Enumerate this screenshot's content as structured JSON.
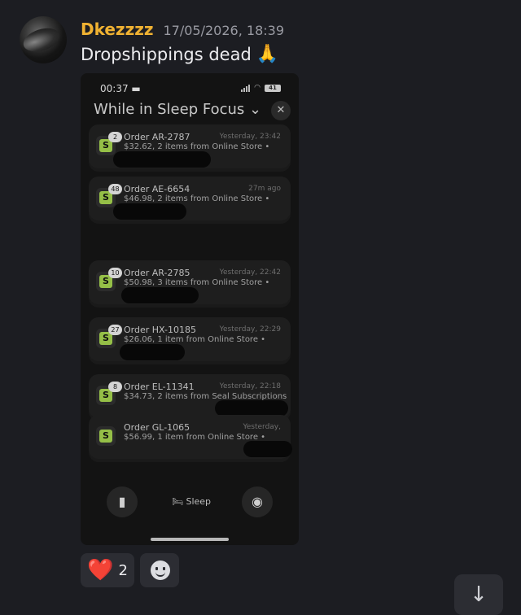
{
  "message": {
    "author": "Dkezzzz",
    "timestamp": "17/05/2026, 18:39",
    "text": "Dropshippings dead",
    "emoji": "🙏"
  },
  "phone": {
    "status_time": "00:37",
    "battery": "41",
    "focus_title": "While in Sleep Focus ⌄",
    "close_glyph": "✕",
    "notifications": [
      {
        "badge": "2",
        "title": "Order AR-2787",
        "time": "Yesterday, 23:42",
        "body": "$32.62, 2 items from Online Store •"
      },
      {
        "badge": "48",
        "title": "Order AE-6654",
        "time": "27m ago",
        "body": "$46.98, 2 items from Online Store •"
      },
      {
        "badge": "10",
        "title": "Order AR-2785",
        "time": "Yesterday, 22:42",
        "body": "$50.98, 3 items from Online Store •"
      },
      {
        "badge": "27",
        "title": "Order HX-10185",
        "time": "Yesterday, 22:29",
        "body": "$26.06, 1 item from Online Store •"
      },
      {
        "badge": "8",
        "title": "Order EL-11341",
        "time": "Yesterday, 22:18",
        "body": "$34.73, 2 items from Seal Subscriptions"
      },
      {
        "badge": "",
        "title": "Order GL-1065",
        "time": "Yesterday,",
        "body": "$56.99, 1 item from Online Store •"
      }
    ],
    "sleep_label": "🛏 Sleep"
  },
  "reactions": [
    {
      "emoji": "❤️",
      "count": "2"
    }
  ],
  "icons": {
    "flashlight": "flashlight-icon",
    "camera": "camera-icon",
    "add_reaction": "add-reaction-icon",
    "scroll_down": "arrow-down-icon"
  },
  "colors": {
    "background": "#1c1d22",
    "username": "#f0b232",
    "shopify_green": "#95bf47",
    "heart": "#e8223a"
  }
}
